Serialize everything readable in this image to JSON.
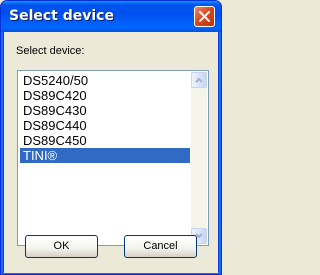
{
  "window": {
    "title": "Select device"
  },
  "dialog": {
    "prompt": "Select device:",
    "devices": [
      {
        "label": "DS5240/50",
        "selected": false
      },
      {
        "label": "DS89C420",
        "selected": false
      },
      {
        "label": "DS89C430",
        "selected": false
      },
      {
        "label": "DS89C440",
        "selected": false
      },
      {
        "label": "DS89C450",
        "selected": false
      },
      {
        "label": "TINI®",
        "selected": true
      }
    ],
    "ok_label": "OK",
    "cancel_label": "Cancel"
  },
  "icons": {
    "close": "close-icon",
    "scroll_up": "chevron-up-icon",
    "scroll_down": "chevron-down-icon"
  },
  "colors": {
    "titlebar": "#0053ee",
    "selection": "#316ac5",
    "close_button": "#d8441c"
  }
}
